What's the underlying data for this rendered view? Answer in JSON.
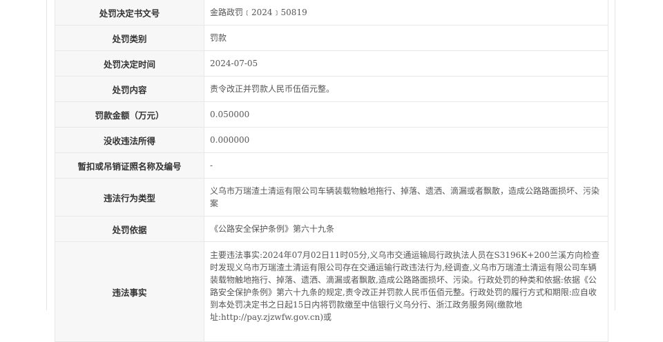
{
  "rows": [
    {
      "label": "处罚决定书文号",
      "value": "金路政罚﹝2024﹞50819"
    },
    {
      "label": "处罚类别",
      "value": "罚款"
    },
    {
      "label": "处罚决定时间",
      "value": "2024-07-05"
    },
    {
      "label": "处罚内容",
      "value": "责令改正并罚款人民币伍佰元整。"
    },
    {
      "label": "罚款金额（万元）",
      "value": "0.050000"
    },
    {
      "label": "没收违法所得",
      "value": "0.000000"
    },
    {
      "label": "暂扣或吊销证照名称及编号",
      "value": "-"
    },
    {
      "label": "违法行为类型",
      "value": "义乌市万瑞渣土清运有限公司车辆装载物触地拖行、掉落、遗洒、滴漏或者飘散，造成公路路面损坏、污染案"
    },
    {
      "label": "处罚依据",
      "value": "《公路安全保护条例》第六十九条"
    },
    {
      "label": "违法事实",
      "value": "主要违法事实:2024年07月02日11时05分,义乌市交通运输局行政执法人员在S3196K+200兰溪方向检查时发现义乌市万瑞渣土清运有限公司存在交通运输行政违法行为,经调查,义乌市万瑞渣土清运有限公司车辆装载物触地拖行、掉落、遗洒、滴漏或者飘散,造成公路路面损坏、污染。行政处罚的种类和依据:依据《公路安全保护条例》第六十九条的规定,责令改正并罚款人民币伍佰元整。行政处罚的履行方式和期限:应自收到本处罚决定书之日起15日内将罚款缴至中信银行义乌分行、浙江政务服务网(缴款地址:http://pay.zjzwfw.gov.cn)或"
    }
  ]
}
